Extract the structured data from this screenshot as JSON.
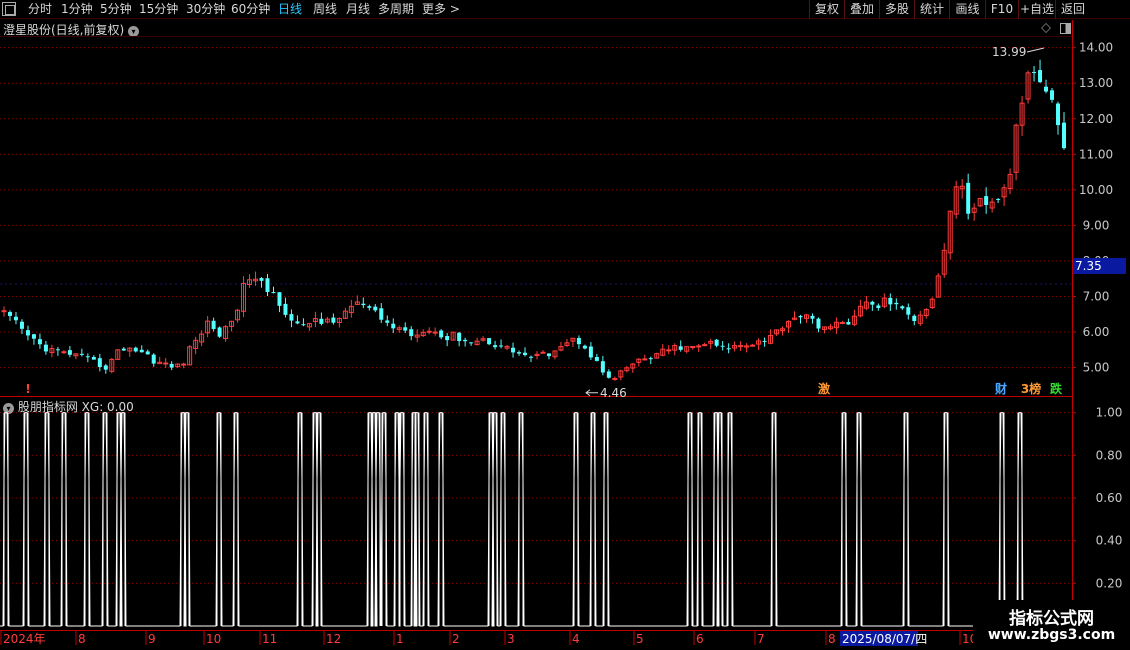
{
  "toolbar": {
    "left_items": [
      "分时",
      "1分钟",
      "5分钟",
      "15分钟",
      "30分钟",
      "60分钟",
      "日线",
      "周线",
      "月线",
      "多周期",
      "更多 >"
    ],
    "active": "日线",
    "right_items": [
      "复权",
      "叠加",
      "多股",
      "统计",
      "画线",
      "F10",
      "+自选",
      "返回"
    ]
  },
  "main_panel": {
    "title": "澄星股份(日线,前复权)",
    "high_label": "13.99",
    "low_label": "4.46",
    "current_price": "7.35",
    "y_ticks": [
      "14.00",
      "13.00",
      "12.00",
      "11.00",
      "10.00",
      "9.00",
      "8.00",
      "7.00",
      "6.00",
      "5.00"
    ],
    "markers": [
      {
        "text": "激",
        "color": "#ff9933"
      },
      {
        "text": "财",
        "color": "#4aa8ff"
      },
      {
        "text": "3榜",
        "color": "#ff9933"
      },
      {
        "text": "跌",
        "color": "#33dd33"
      }
    ],
    "left_marker": "!"
  },
  "indicator_panel": {
    "title": "股朋指标网",
    "value_label": "XG: 0.00",
    "y_ticks": [
      "1.00",
      "0.80",
      "0.60",
      "0.40",
      "0.20"
    ]
  },
  "date_axis": {
    "labels": [
      "2024年",
      "8",
      "9",
      "10",
      "11",
      "12",
      "1",
      "2",
      "3",
      "4",
      "5",
      "6",
      "7",
      "8",
      "10"
    ],
    "highlight_date": "2025/08/07/四"
  },
  "watermark": {
    "logo": "指标公式网",
    "url": "www.zbgs3.com"
  },
  "colors": {
    "up": "#ff3c3c",
    "down": "#54ffff",
    "grid": "#8a0000",
    "axis": "#c00000",
    "indicator_line": "#ffffff",
    "price_label_bg": "#0a1aa0"
  },
  "chart_data": [
    {
      "type": "candlestick",
      "title": "澄星股份(日线,前复权)",
      "ylim": [
        4.2,
        14.3
      ],
      "annotations": [
        {
          "text": "13.99",
          "value": 13.99,
          "kind": "high"
        },
        {
          "text": "4.46",
          "value": 4.46,
          "kind": "low"
        }
      ],
      "close_trend": [
        6.5,
        6.3,
        6.0,
        5.8,
        5.6,
        5.5,
        5.4,
        5.4,
        5.3,
        5.2,
        5.1,
        5.0,
        5.4,
        5.6,
        5.5,
        5.4,
        5.2,
        5.1,
        5.0,
        5.1,
        5.6,
        6.0,
        6.3,
        5.9,
        6.2,
        6.8,
        7.6,
        7.4,
        7.2,
        7.0,
        6.6,
        6.2,
        6.1,
        6.4,
        6.3,
        6.2,
        6.5,
        6.7,
        6.8,
        6.6,
        6.4,
        6.2,
        6.1,
        6.0,
        5.9,
        6.2,
        6.0,
        5.8,
        5.9,
        5.8,
        5.7,
        5.8,
        5.7,
        5.6,
        5.5,
        5.4,
        5.3,
        5.3,
        5.4,
        5.6,
        5.7,
        5.8,
        5.6,
        5.2,
        4.8,
        4.6,
        4.9,
        5.1,
        5.2,
        5.3,
        5.4,
        5.5,
        5.6,
        5.5,
        5.6,
        5.7,
        5.6,
        5.5,
        5.6,
        5.7,
        5.7,
        5.8,
        5.9,
        6.2,
        6.4,
        6.5,
        6.3,
        6.2,
        6.1,
        6.2,
        6.3,
        6.6,
        6.8,
        6.7,
        6.9,
        6.8,
        6.5,
        6.4,
        6.6,
        7.0,
        8.0,
        9.6,
        10.3,
        9.2,
        9.6,
        9.4,
        9.8,
        10.1,
        11.8,
        13.2,
        13.5,
        13.0,
        12.3,
        11.2
      ]
    },
    {
      "type": "line",
      "series_name": "XG",
      "ylim": [
        0,
        1.05
      ],
      "signal_x": [
        6,
        26,
        47,
        64,
        87,
        105,
        119,
        123,
        183,
        187,
        219,
        236,
        300,
        315,
        319,
        370,
        374,
        378,
        384,
        397,
        402,
        414,
        417,
        426,
        441,
        491,
        495,
        503,
        521,
        576,
        593,
        606,
        690,
        700,
        716,
        720,
        730,
        774,
        844,
        859,
        906,
        946,
        1002,
        1020
      ]
    }
  ]
}
